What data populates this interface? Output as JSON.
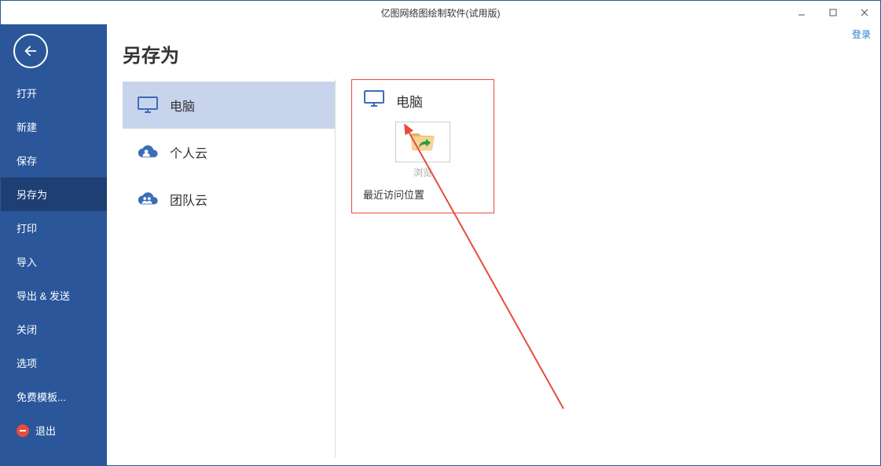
{
  "window": {
    "title": "亿图网络图绘制软件(试用版)",
    "login": "登录"
  },
  "sidebar": {
    "items": [
      {
        "label": "打开"
      },
      {
        "label": "新建"
      },
      {
        "label": "保存"
      },
      {
        "label": "另存为"
      },
      {
        "label": "打印"
      },
      {
        "label": "导入"
      },
      {
        "label": "导出 & 发送"
      },
      {
        "label": "关闭"
      },
      {
        "label": "选项"
      },
      {
        "label": "免费模板..."
      },
      {
        "label": "退出"
      }
    ]
  },
  "page": {
    "title": "另存为"
  },
  "locations": {
    "items": [
      {
        "label": "电脑"
      },
      {
        "label": "个人云"
      },
      {
        "label": "团队云"
      }
    ]
  },
  "detail": {
    "header": "电脑",
    "browse": "浏览",
    "recent": "最近访问位置"
  }
}
